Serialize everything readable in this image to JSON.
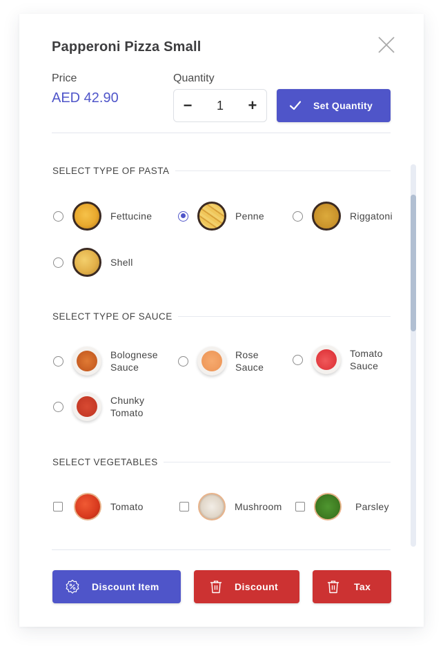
{
  "dialog": {
    "title": "Papperoni Pizza Small",
    "close_icon": "close-icon"
  },
  "price": {
    "label": "Price",
    "value": "AED 42.90"
  },
  "quantity": {
    "label": "Quantity",
    "value": "1",
    "decrement_label": "−",
    "increment_label": "+",
    "set_button_label": "Set Quantity",
    "set_button_icon": "check-icon"
  },
  "sections": [
    {
      "title": "SELECT TYPE OF PASTA",
      "input_type": "radio",
      "options": [
        {
          "label": "Fettucine",
          "selected": false,
          "color": "#e9a92e"
        },
        {
          "label": "Penne",
          "selected": true,
          "color": "#e2b24a"
        },
        {
          "label": "Riggatoni",
          "selected": false,
          "color": "#d09a2c"
        },
        {
          "label": "Shell",
          "selected": false,
          "color": "#e6b64c"
        }
      ]
    },
    {
      "title": "SELECT TYPE OF SAUCE",
      "input_type": "radio",
      "options": [
        {
          "label_line1": "Bolognese",
          "label_line2": "Sauce",
          "selected": false,
          "color": "#d0692a"
        },
        {
          "label_line1": "Rose",
          "label_line2": "Sauce",
          "selected": false,
          "color": "#ef9a5c"
        },
        {
          "label_line1": "Tomato",
          "label_line2": "Sauce",
          "selected": false,
          "color": "#e0373c"
        },
        {
          "label_line1": "Chunky",
          "label_line2": "Tomato",
          "selected": false,
          "color": "#c63a26"
        }
      ]
    },
    {
      "title": "SELECT VEGETABLES",
      "input_type": "checkbox",
      "options": [
        {
          "label": "Tomato",
          "checked": false,
          "color": "#d83a1e"
        },
        {
          "label": "Mushroom",
          "checked": false,
          "color": "#e8e2d8"
        },
        {
          "label": "Parsley",
          "checked": false,
          "color": "#3f7d22"
        }
      ]
    }
  ],
  "actions": {
    "discount_item": {
      "label": "Discount Item",
      "icon": "discount-badge-icon",
      "color": "#4f55c9"
    },
    "discount": {
      "label": "Discount",
      "icon": "trash-icon",
      "color": "#cc3232"
    },
    "tax": {
      "label": "Tax",
      "icon": "trash-icon",
      "color": "#cc3232"
    }
  },
  "colors": {
    "accent": "#4f55c9",
    "danger": "#cc3232",
    "scroll_thumb": "#b1bfd2",
    "scroll_track": "#e8ecf4"
  }
}
